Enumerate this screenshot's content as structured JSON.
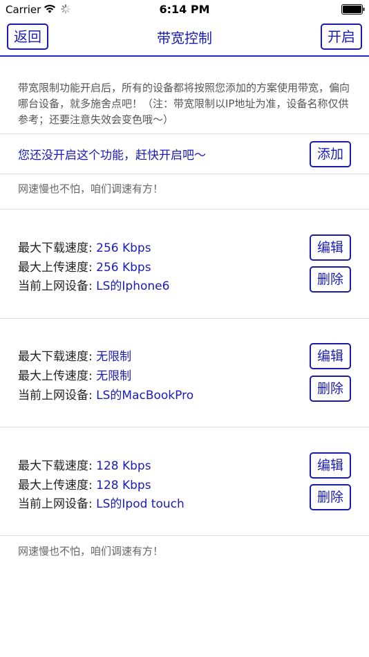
{
  "status_bar": {
    "carrier": "Carrier",
    "time": "6:14 PM",
    "icons": [
      "wifi-icon",
      "spinner-icon",
      "battery-icon"
    ]
  },
  "nav": {
    "back_label": "返回",
    "title": "带宽控制",
    "open_label": "开启"
  },
  "description": "带宽限制功能开启后，所有的设备都将按照您添加的方案使用带宽，偏向哪台设备，就多施舍点吧！（注：带宽限制以IP地址为准，设备名称仅供参考；还要注意失效会变色哦～）",
  "notice": "您还没开启这个功能，赶快开启吧～",
  "add_label": "添加",
  "slogan": "网速慢也不怕，咱们调速有方！",
  "labels": {
    "download": "最大下载速度:",
    "upload": "最大上传速度:",
    "device": "当前上网设备:",
    "edit": "编辑",
    "delete": "删除"
  },
  "rules": [
    {
      "download": "256 Kbps",
      "upload": "256 Kbps",
      "device": "LS的Iphone6"
    },
    {
      "download": "无限制",
      "upload": "无限制",
      "device": "LS的MacBookPro"
    },
    {
      "download": "128 Kbps",
      "upload": "128 Kbps",
      "device": "LS的Ipod touch"
    }
  ],
  "colors": {
    "accent": "#1a1ab8",
    "text": "#222222",
    "muted": "#666666",
    "divider": "#dddddd"
  }
}
